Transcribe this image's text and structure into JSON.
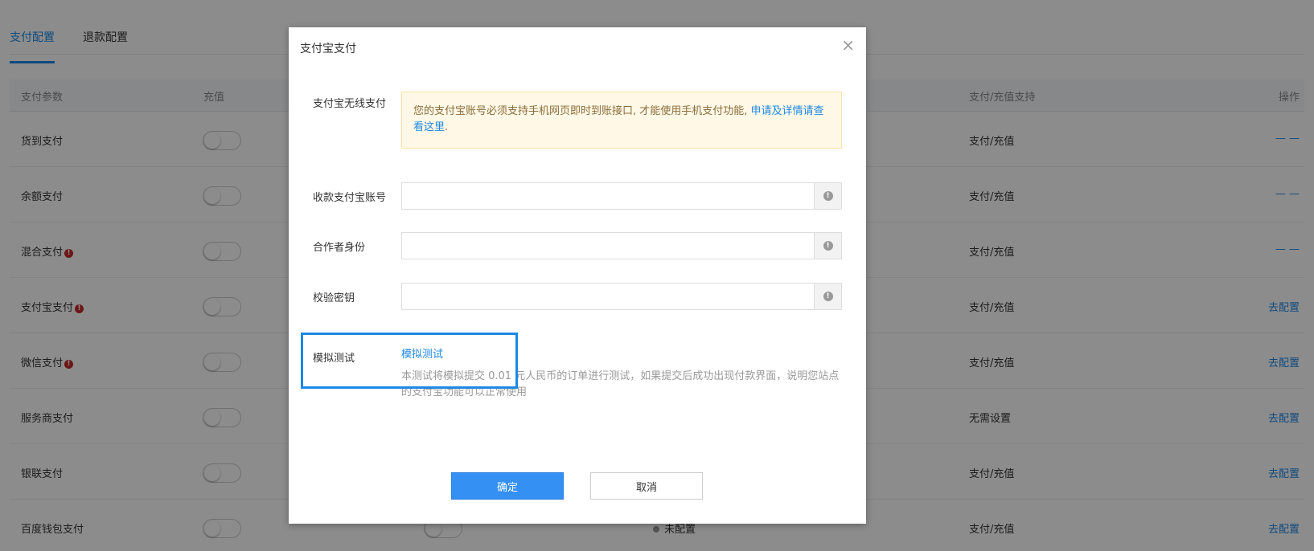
{
  "tabs": [
    "支付配置",
    "退款配置"
  ],
  "table": {
    "headers": [
      "支付参数",
      "充值",
      "支付/充值支持",
      "操作"
    ],
    "rows": [
      {
        "name": "货到支付",
        "warn": false,
        "support": "支付/充值",
        "op": "— —"
      },
      {
        "name": "余额支付",
        "warn": false,
        "support": "支付/充值",
        "op": "— —"
      },
      {
        "name": "混合支付",
        "warn": true,
        "support": "支付/充值",
        "op": "— —"
      },
      {
        "name": "支付宝支付",
        "warn": true,
        "support": "支付/充值",
        "op": "去配置"
      },
      {
        "name": "微信支付",
        "warn": true,
        "support": "支付/充值",
        "op": "去配置"
      },
      {
        "name": "服务商支付",
        "warn": false,
        "support": "无需设置",
        "op": "去配置"
      },
      {
        "name": "银联支付",
        "warn": false,
        "support": "支付/充值",
        "op": "去配置"
      },
      {
        "name": "百度钱包支付",
        "warn": false,
        "support": "支付/充值",
        "op": "去配置",
        "status": "未配置"
      }
    ]
  },
  "modal": {
    "title": "支付宝支付",
    "close": "×",
    "wireless_label": "支付宝无线支付",
    "notice_text": "您的支付宝账号必须支持手机网页即时到账接口, 才能使用手机支付功能,",
    "notice_link": "申请及详情请查看这里",
    "notice_end": ".",
    "fields": [
      {
        "label": "收款支付宝账号",
        "value": ""
      },
      {
        "label": "合作者身份",
        "value": ""
      },
      {
        "label": "校验密钥",
        "value": ""
      }
    ],
    "test_label": "模拟测试",
    "test_link": "模拟测试",
    "test_help": "本测试将模拟提交 0.01 元人民币的订单进行测试，如果提交后成功出现付款界面，说明您站点的支付宝功能可以正常使用",
    "ok": "确定",
    "cancel": "取消"
  },
  "colors": {
    "accent": "#1e88e5",
    "warning": "#c62828"
  }
}
